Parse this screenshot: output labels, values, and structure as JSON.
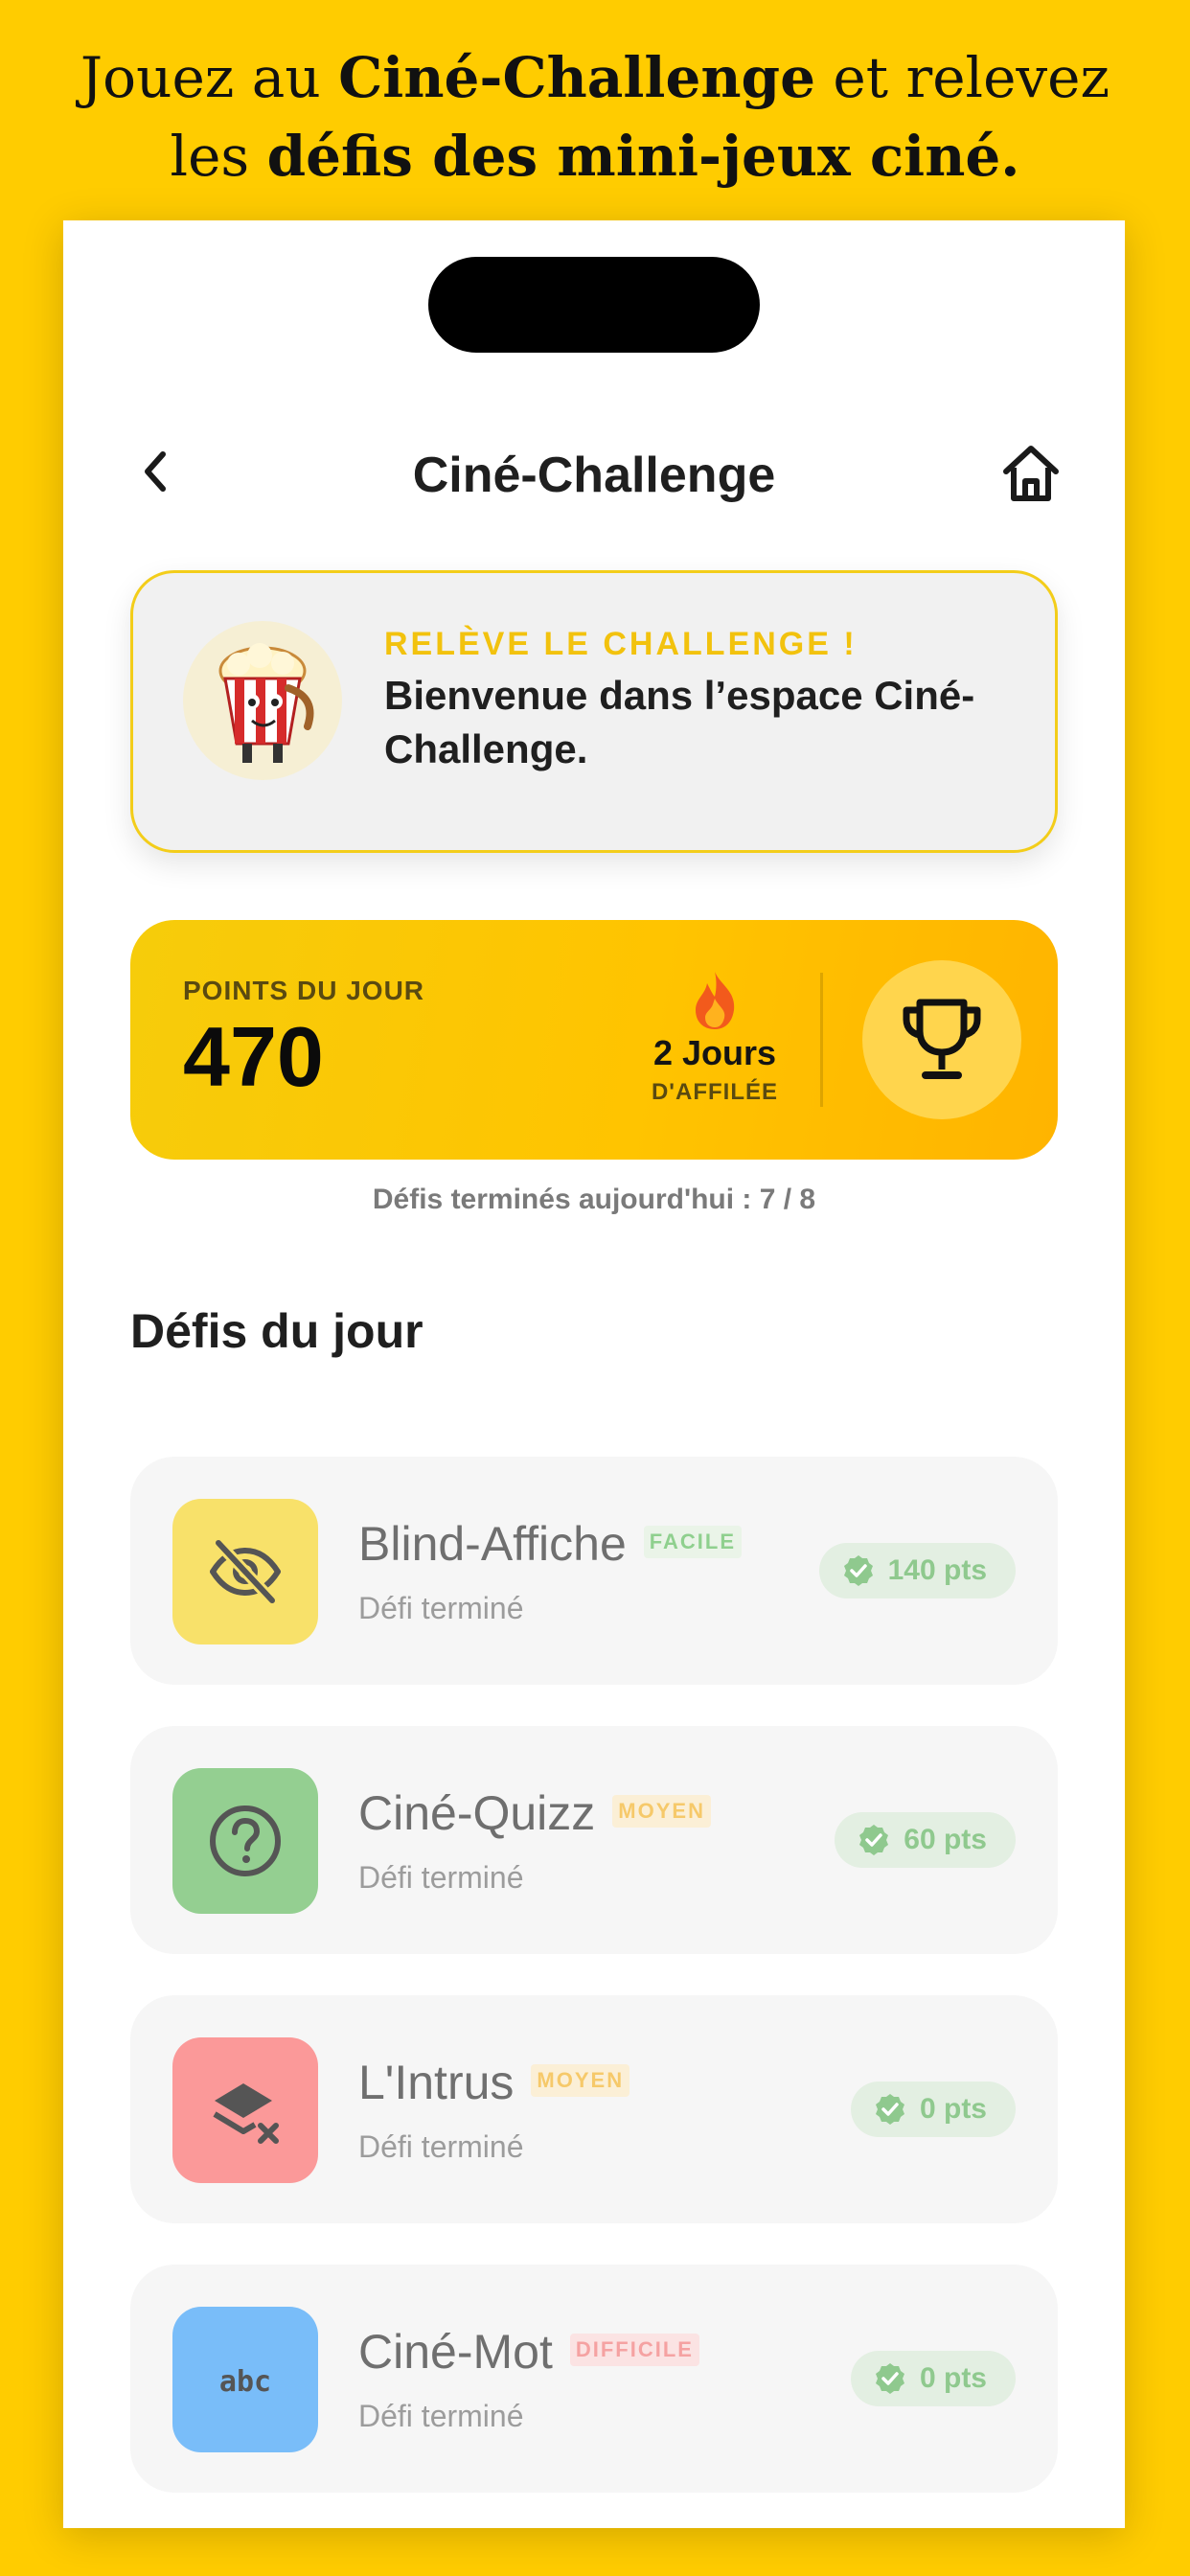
{
  "promo": {
    "line1_a": "Jouez au ",
    "line1_b": "Ciné-Challenge",
    "line1_c": " et relevez",
    "line2_a": "les ",
    "line2_b": "défis des mini-jeux ciné."
  },
  "nav": {
    "title": "Ciné-Challenge",
    "back_icon": "chevron-left-icon",
    "home_icon": "home-icon"
  },
  "welcome": {
    "kicker": "RELÈVE LE CHALLENGE !",
    "message": "Bienvenue dans l’espace Ciné-Challenge.",
    "mascot": "popcorn-mascot"
  },
  "points": {
    "label": "POINTS DU JOUR",
    "value": "470",
    "streak": "2 Jours",
    "streak_sub": "D'AFFILÉE",
    "streak_icon": "flame-icon",
    "trophy_icon": "trophy-icon"
  },
  "done_today": "Défis terminés aujourd'hui : 7 / 8",
  "section_title": "Défis du jour",
  "challenges": [
    {
      "name": "Blind-Affiche",
      "level": "FACILE",
      "status": "Défi terminé",
      "points": "140 pts",
      "icon": "eye-off-icon",
      "tile_color": "#f8e16a",
      "level_color": "#8fd08e",
      "level_bg": "#eaf4e8"
    },
    {
      "name": "Ciné-Quizz",
      "level": "MOYEN",
      "status": "Défi terminé",
      "points": "60 pts",
      "icon": "question-circle-icon",
      "tile_color": "#94cf91",
      "level_color": "#f6c96a",
      "level_bg": "#fbefd6"
    },
    {
      "name": "L'Intrus",
      "level": "MOYEN",
      "status": "Défi terminé",
      "points": "0 pts",
      "icon": "layer-remove-icon",
      "tile_color": "#fb9999",
      "level_color": "#f6c96a",
      "level_bg": "#fbefd6"
    },
    {
      "name": "Ciné-Mot",
      "level": "DIFFICILE",
      "status": "Défi terminé",
      "points": "0 pts",
      "icon": "abc-icon",
      "tile_color": "#79bdf9",
      "level_color": "#f5a2a2",
      "level_bg": "#fbe3e3"
    }
  ],
  "colors": {
    "brand_yellow": "#FFCC00",
    "points_green": "#8fc98e"
  }
}
